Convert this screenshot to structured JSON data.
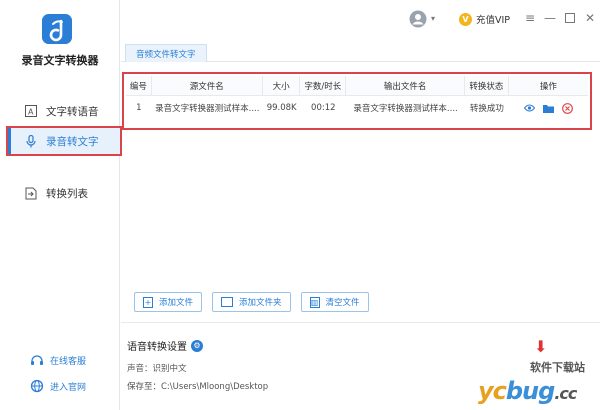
{
  "app": {
    "name": "录音文字转换器"
  },
  "sidebar": {
    "items": [
      {
        "label": "文字转语音",
        "icon": "text-to-speech-icon"
      },
      {
        "label": "录音转文字",
        "icon": "microphone-icon",
        "active": true
      },
      {
        "label": "转换列表",
        "icon": "convert-list-icon"
      }
    ],
    "footer": [
      {
        "label": "在线客服",
        "icon": "headset-icon"
      },
      {
        "label": "进入官网",
        "icon": "globe-icon"
      }
    ]
  },
  "titlebar": {
    "vip_label": "充值VIP",
    "vip_badge": "V"
  },
  "tabs": [
    {
      "label": "音频文件转文字"
    }
  ],
  "table": {
    "headers": [
      "编号",
      "源文件名",
      "大小",
      "字数/时长",
      "输出文件名",
      "转换状态",
      "操作"
    ],
    "rows": [
      {
        "index": "1",
        "source": "录音文字转换器测试样本....",
        "size": "99.08K",
        "duration": "00:12",
        "output": "录音文字转换器测试样本....",
        "status": "转换成功"
      }
    ]
  },
  "buttons": {
    "add_file": "添加文件",
    "add_folder": "添加文件夹",
    "clear_files": "清空文件"
  },
  "settings": {
    "title": "语音转换设置",
    "voice": "声音：识别中文",
    "save_to": "保存至：C:\\Users\\Mloong\\Desktop"
  },
  "watermark": {
    "brand": "yc",
    "brand2": "bug",
    "suffix": ".cc",
    "subtitle": "软件下载站"
  },
  "colors": {
    "accent": "#2b7ed6",
    "highlight_border": "#d9434a",
    "danger": "#e04a4a",
    "vip": "#f2b51c"
  }
}
